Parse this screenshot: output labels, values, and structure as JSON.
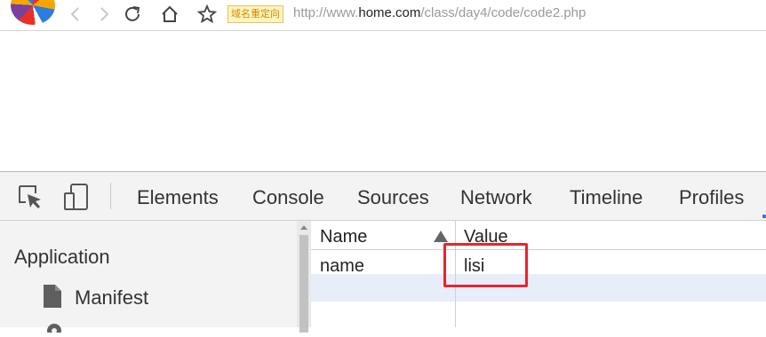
{
  "browser": {
    "redirect_badge": "域名重定向",
    "url_prefix": "http://www.",
    "url_host": "home.com",
    "url_path": "/class/day4/code/code2.php"
  },
  "devtools": {
    "tabs": [
      "Elements",
      "Console",
      "Sources",
      "Network",
      "Timeline",
      "Profiles"
    ],
    "sidebar": {
      "title": "Application",
      "items": [
        {
          "label": "Manifest"
        }
      ]
    },
    "table": {
      "columns": [
        "Name",
        "Value"
      ],
      "rows": [
        {
          "name": "name",
          "value": "lisi"
        }
      ],
      "sort_direction": "ascending"
    }
  },
  "colors": {
    "highlight": "#e5262d",
    "selected_row": "#e7eef9",
    "badge_bg": "#fff4c2"
  }
}
